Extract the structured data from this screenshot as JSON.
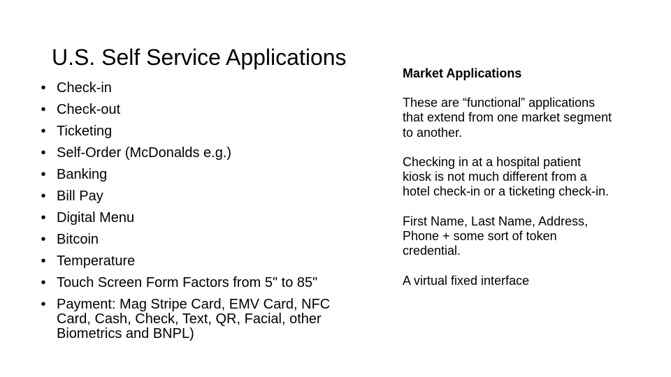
{
  "slide": {
    "title": "U.S. Self Service Applications",
    "bullet_glyph": "•",
    "bullets": [
      "Check-in",
      "Check-out",
      "Ticketing",
      "Self-Order (McDonalds e.g.)",
      "Banking",
      "Bill Pay",
      "Digital Menu",
      "Bitcoin",
      "Temperature",
      "Touch Screen Form Factors from 5\" to 85\"",
      "Payment:  Mag Stripe Card, EMV Card, NFC Card, Cash, Check, Text, QR, Facial, other Biometrics and BNPL)"
    ],
    "right_panel": {
      "heading": "Market Applications",
      "paragraphs": [
        "These are “functional” applications that extend from one market segment to another.",
        "Checking in at a hospital patient kiosk is not much different from a hotel check-in or a ticketing check-in.",
        "First Name, Last Name, Address, Phone + some sort of token credential.",
        "A virtual fixed interface"
      ]
    }
  }
}
